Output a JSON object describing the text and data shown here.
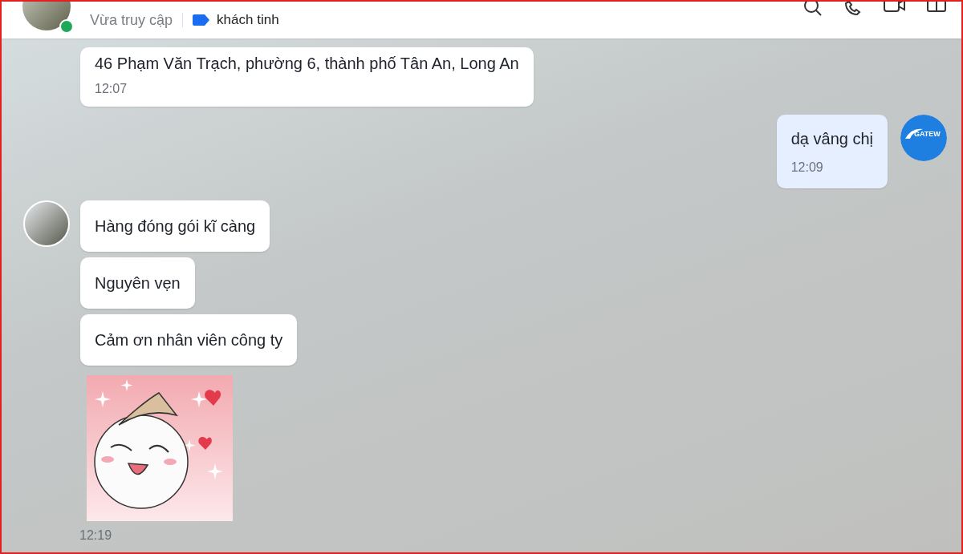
{
  "header": {
    "online": true,
    "status": "Vừa truy cập",
    "tag": {
      "label": "khách tinh",
      "color": "#1a6cf0"
    }
  },
  "messages": [
    {
      "outgoing": false,
      "kind": "text",
      "avatar": false,
      "text": "46 Phạm Văn Trạch, phường 6, thành phố Tân An, Long An",
      "time": "12:07"
    },
    {
      "outgoing": true,
      "kind": "text",
      "avatar": true,
      "avatar_text": "GATEW",
      "text": "dạ vâng chị",
      "time": "12:09"
    },
    {
      "outgoing": false,
      "kind": "text",
      "avatar": true,
      "text": "Hàng đóng gói kĩ càng"
    },
    {
      "outgoing": false,
      "kind": "text",
      "avatar": false,
      "text": "Nguyên vẹn"
    },
    {
      "outgoing": false,
      "kind": "text",
      "avatar": false,
      "text": "Cảm ơn nhân viên công ty"
    },
    {
      "outgoing": false,
      "kind": "sticker",
      "avatar": false,
      "time": "12:19"
    }
  ]
}
